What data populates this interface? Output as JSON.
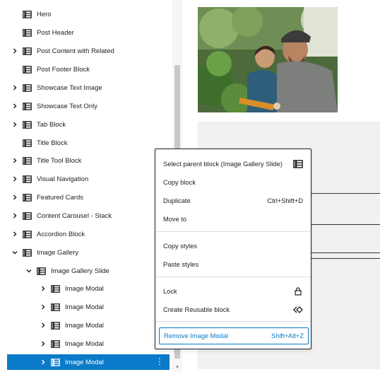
{
  "list_view": {
    "items": [
      {
        "label": "Hero",
        "expandable": false,
        "depth": 0
      },
      {
        "label": "Post Header",
        "expandable": false,
        "depth": 0
      },
      {
        "label": "Post Content with Related",
        "expandable": true,
        "depth": 0
      },
      {
        "label": "Post Footer Block",
        "expandable": false,
        "depth": 0
      },
      {
        "label": "Showcase Text Image",
        "expandable": true,
        "depth": 0
      },
      {
        "label": "Showcase Text Only",
        "expandable": true,
        "depth": 0
      },
      {
        "label": "Tab Block",
        "expandable": true,
        "depth": 0
      },
      {
        "label": "Title Block",
        "expandable": false,
        "depth": 0
      },
      {
        "label": "Title Tool Block",
        "expandable": true,
        "depth": 0
      },
      {
        "label": "Visual Navigation",
        "expandable": true,
        "depth": 0
      },
      {
        "label": "Featured Cards",
        "expandable": true,
        "depth": 0
      },
      {
        "label": "Content Carousel - Stack",
        "expandable": true,
        "depth": 0
      },
      {
        "label": "Accordion Block",
        "expandable": true,
        "depth": 0
      },
      {
        "label": "Image Gallery",
        "expandable": true,
        "expanded": true,
        "depth": 0
      },
      {
        "label": "Image Gallery Slide",
        "expandable": true,
        "expanded": true,
        "depth": 1
      },
      {
        "label": "Image Modal",
        "expandable": true,
        "depth": 2
      },
      {
        "label": "Image Modal",
        "expandable": true,
        "depth": 2
      },
      {
        "label": "Image Modal",
        "expandable": true,
        "depth": 2
      },
      {
        "label": "Image Modal",
        "expandable": true,
        "depth": 2
      },
      {
        "label": "Image Modal",
        "expandable": true,
        "depth": 2,
        "selected": true
      }
    ]
  },
  "context_menu": {
    "groups": [
      [
        {
          "label": "Select parent block (Image Gallery Slide)",
          "shortcut": "",
          "icon": "block-icon"
        },
        {
          "label": "Copy block",
          "shortcut": ""
        },
        {
          "label": "Duplicate",
          "shortcut": "Ctrl+Shift+D"
        },
        {
          "label": "Move to",
          "shortcut": ""
        }
      ],
      [
        {
          "label": "Copy styles",
          "shortcut": ""
        },
        {
          "label": "Paste styles",
          "shortcut": ""
        }
      ],
      [
        {
          "label": "Lock",
          "shortcut": "",
          "icon": "lock-icon"
        },
        {
          "label": "Create Reusable block",
          "shortcut": "",
          "icon": "reusable-icon"
        }
      ],
      [
        {
          "label": "Remove Image Modal",
          "shortcut": "Shift+Alt+Z",
          "danger": true
        }
      ]
    ]
  },
  "colors": {
    "accent": "#0a7ac9",
    "text": "#1e1e1e",
    "menu_border": "#1e1e1e"
  }
}
